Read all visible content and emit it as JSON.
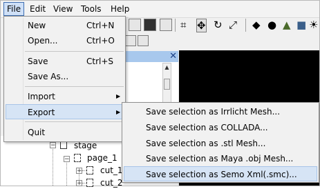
{
  "menubar": {
    "items": [
      "File",
      "Edit",
      "View",
      "Tools",
      "Help"
    ],
    "active": "File"
  },
  "file_menu": {
    "items": [
      {
        "label": "New",
        "shortcut": "Ctrl+N"
      },
      {
        "label": "Open...",
        "shortcut": "Ctrl+O"
      },
      {
        "label": "Save",
        "shortcut": "Ctrl+S"
      },
      {
        "label": "Save As..."
      },
      {
        "label": "Import",
        "submenu": true
      },
      {
        "label": "Export",
        "submenu": true,
        "highlighted": true
      },
      {
        "label": "Quit"
      }
    ]
  },
  "export_submenu": {
    "items": [
      {
        "label": "Save selection as Irrlicht Mesh..."
      },
      {
        "label": "Save selection as COLLADA..."
      },
      {
        "label": "Save selection as .stl Mesh..."
      },
      {
        "label": "Save selection as Maya .obj Mesh..."
      },
      {
        "label": "Save selection as Semo Xml(.smc)...",
        "highlighted": true
      }
    ]
  },
  "panel": {
    "close_glyph": "✕"
  },
  "tree": {
    "nodes": [
      {
        "label": "stage"
      },
      {
        "label": "page_1"
      },
      {
        "label": "cut_1"
      },
      {
        "label": "cut_2"
      }
    ]
  },
  "colors": {
    "highlight": "#d6e4f5",
    "panel_header": "#a8c8ed",
    "viewport": "#000000"
  }
}
